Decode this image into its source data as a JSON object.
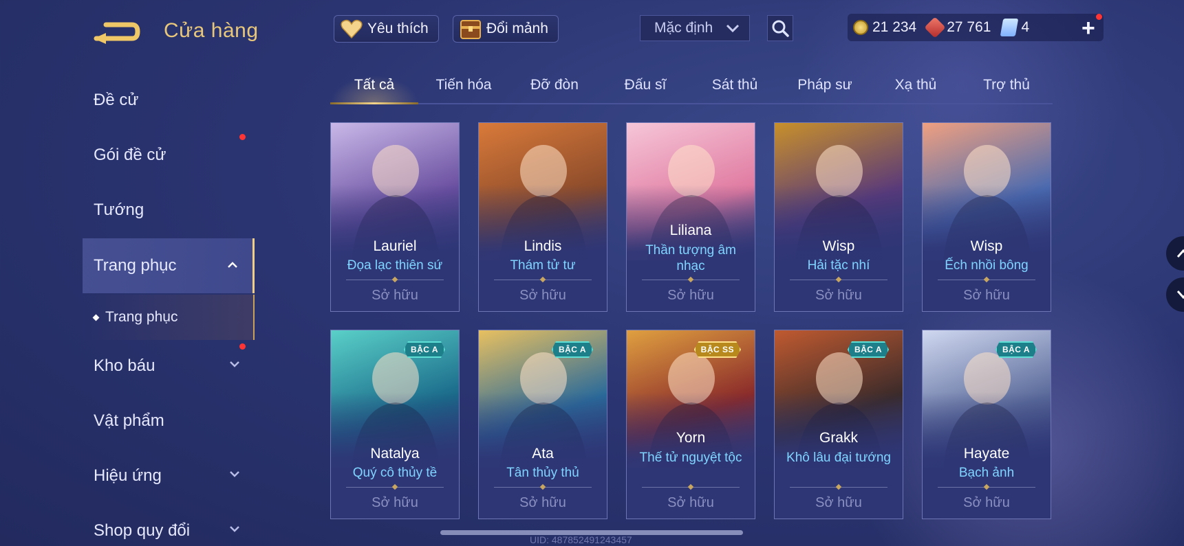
{
  "header": {
    "title": "Cửa hàng",
    "favorites_label": "Yêu thích",
    "exchange_label": "Đổi mảnh",
    "sort_value": "Mặc định"
  },
  "currency": {
    "gold": "21 234",
    "ruby": "27 761",
    "tickets": "4"
  },
  "sidebar": {
    "items": [
      {
        "label": "Đề cử"
      },
      {
        "label": "Gói đề cử"
      },
      {
        "label": "Tướng"
      },
      {
        "label": "Trang phục"
      },
      {
        "label": "Trang phục"
      },
      {
        "label": "Kho báu"
      },
      {
        "label": "Vật phẩm"
      },
      {
        "label": "Hiệu ứng"
      },
      {
        "label": "Shop quy đổi"
      }
    ]
  },
  "tabs": [
    "Tất cả",
    "Tiến hóa",
    "Đỡ đòn",
    "Đấu sĩ",
    "Sát thủ",
    "Pháp sư",
    "Xạ thủ",
    "Trợ thủ"
  ],
  "cards": [
    {
      "hero": "Lauriel",
      "skin": "Đọa lạc thiên sứ",
      "status": "Sở hữu",
      "badge": "",
      "colors": [
        "#6a4fa0",
        "#c9b8e8"
      ]
    },
    {
      "hero": "Lindis",
      "skin": "Thám tử tư",
      "status": "Sở hữu",
      "badge": "",
      "colors": [
        "#8a4a2a",
        "#d97a3a"
      ]
    },
    {
      "hero": "Liliana",
      "skin": "Thần tượng âm nhạc",
      "status": "Sở hữu",
      "badge": "",
      "colors": [
        "#e07aa0",
        "#f6c6d8"
      ]
    },
    {
      "hero": "Wisp",
      "skin": "Hải tặc nhí",
      "status": "Sở hữu",
      "badge": "",
      "colors": [
        "#5a3a7a",
        "#c8902a"
      ]
    },
    {
      "hero": "Wisp",
      "skin": "Ếch nhồi bông",
      "status": "Sở hữu",
      "badge": "",
      "colors": [
        "#4a6ab0",
        "#f0a080"
      ]
    },
    {
      "hero": "Natalya",
      "skin": "Quý cô thủy tề",
      "status": "Sở hữu",
      "badge": "BẬC A",
      "colors": [
        "#1a6a8a",
        "#5ad0c8"
      ]
    },
    {
      "hero": "Ata",
      "skin": "Tân thủy thủ",
      "status": "Sở hữu",
      "badge": "BẬC A",
      "colors": [
        "#2a6a9a",
        "#e8c060"
      ]
    },
    {
      "hero": "Yorn",
      "skin": "Thế tử nguyệt tộc",
      "status": "Sở hữu",
      "badge": "BẬC SS",
      "colors": [
        "#8a2a2a",
        "#e0a040"
      ]
    },
    {
      "hero": "Grakk",
      "skin": "Khô lâu đại tướng",
      "status": "Sở hữu",
      "badge": "BẬC A",
      "colors": [
        "#3a2a2a",
        "#c05a30"
      ]
    },
    {
      "hero": "Hayate",
      "skin": "Bạch ảnh",
      "status": "Sở hữu",
      "badge": "BẬC A",
      "colors": [
        "#5a6a9a",
        "#d0d8f0"
      ]
    }
  ],
  "uid_text": "UID: 487852491243457"
}
